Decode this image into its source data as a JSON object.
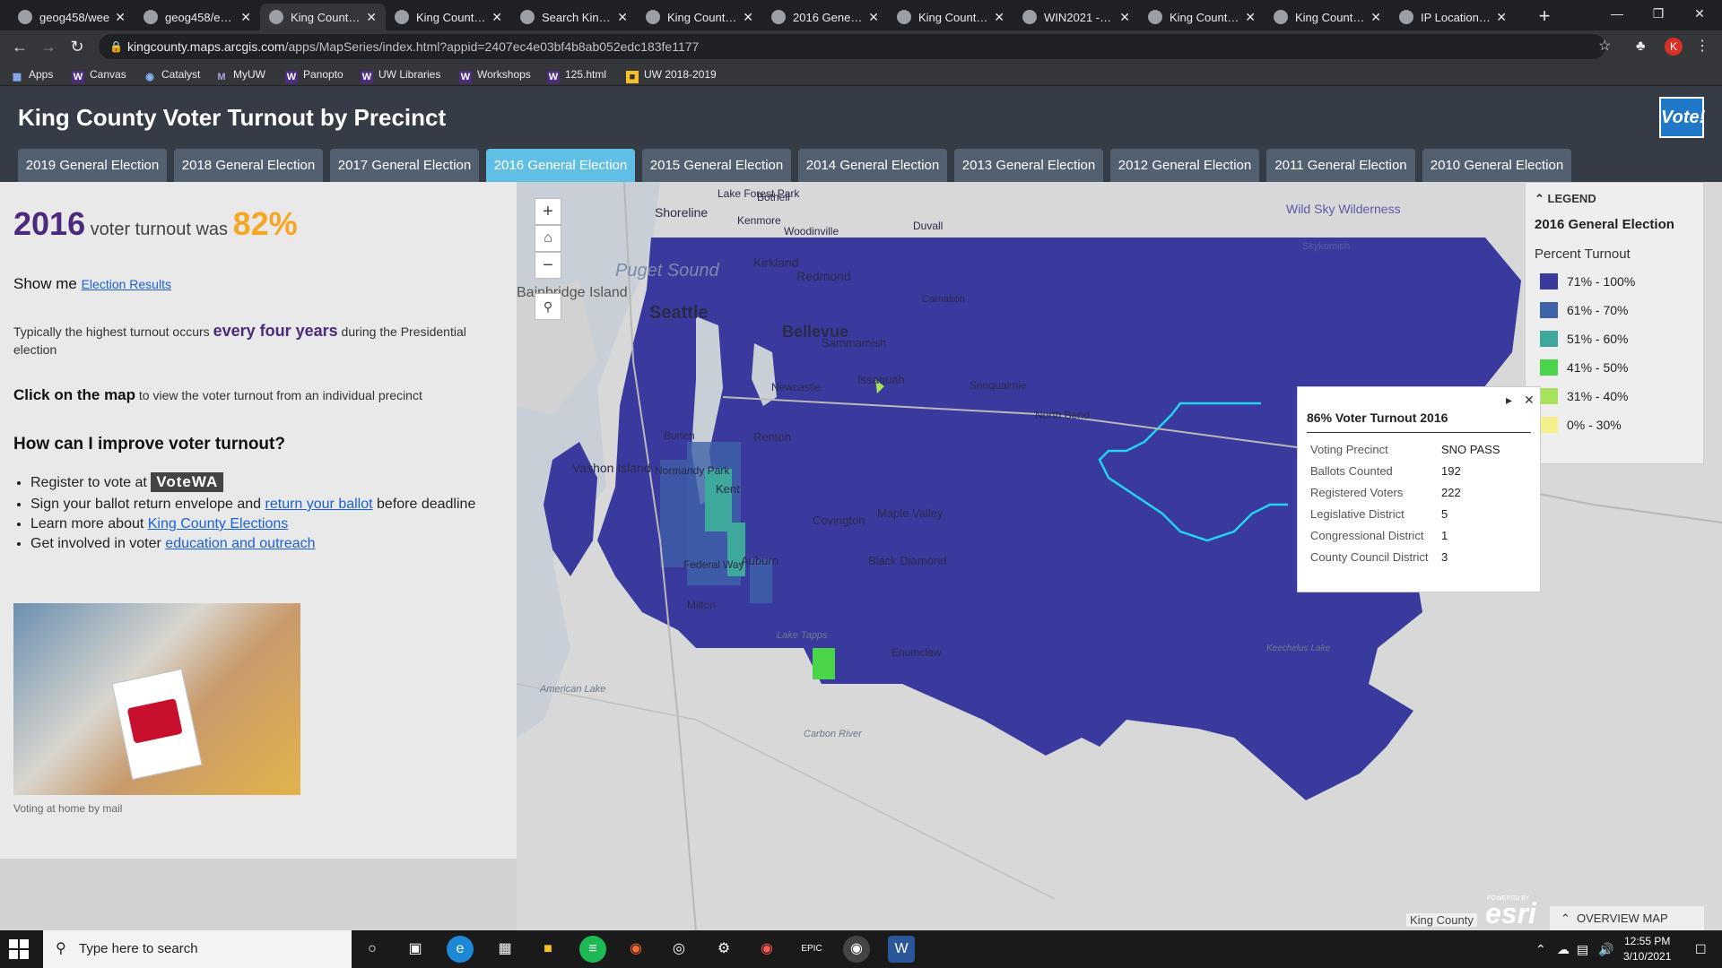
{
  "browser": {
    "tabs": [
      {
        "title": "geog458/wee",
        "icon": "github-icon"
      },
      {
        "title": "geog458/essa",
        "icon": "github-icon"
      },
      {
        "title": "King County V",
        "icon": "arcgis-icon",
        "active": true
      },
      {
        "title": "King County V",
        "icon": "arcgis-icon"
      },
      {
        "title": "Search King C",
        "icon": "search-page-icon"
      },
      {
        "title": "King County G",
        "icon": "page-icon"
      },
      {
        "title": "2016 General",
        "icon": "page-icon"
      },
      {
        "title": "King County G",
        "icon": "page-icon"
      },
      {
        "title": "WIN2021 - Go",
        "icon": "google-drive-icon"
      },
      {
        "title": "King County V",
        "icon": "arcgis-icon"
      },
      {
        "title": "King County V",
        "icon": "arcgis-icon"
      },
      {
        "title": "IP Location Fi",
        "icon": "location-icon"
      }
    ],
    "url_host": "kingcounty.maps.arcgis.com",
    "url_path": "/apps/MapSeries/index.html?appid=2407ec4e03bf4b8ab052edc183fe1177",
    "profile_initial": "K",
    "bookmarks": [
      "Apps",
      "Canvas",
      "Catalyst",
      "MyUW",
      "Panopto",
      "UW Libraries",
      "Workshops",
      "125.html",
      "UW 2018-2019"
    ]
  },
  "app": {
    "title": "King County Voter Turnout by Precinct",
    "logo_text": "Vote!",
    "tabs": [
      "2019 General Election",
      "2018 General Election",
      "2017 General Election",
      "2016 General Election",
      "2015 General Election",
      "2014 General Election",
      "2013 General Election",
      "2012 General Election",
      "2011 General Election",
      "2010 General Election"
    ],
    "active_tab_index": 3
  },
  "panel": {
    "year": "2016",
    "turnout_label": " voter turnout was ",
    "turnout_value": "82%",
    "show_me_prefix": "Show me ",
    "show_me_link": "Election Results",
    "typical_prefix": "Typically the highest turnout occurs ",
    "typical_emph": "every four years",
    "typical_suffix": " during the Presidential election",
    "click_bold": "Click on the map",
    "click_rest": " to view the voter turnout from an individual precinct",
    "improve_heading": "How can I improve voter turnout?",
    "bullet1_prefix": "Register to vote at ",
    "bullet1_badge": "VoteWA",
    "bullet2_prefix": "Sign your ballot return envelope and ",
    "bullet2_link": "return your ballot",
    "bullet2_suffix": " before deadline",
    "bullet3_prefix": "Learn more about ",
    "bullet3_link": "King County Elections",
    "bullet4_prefix": "Get involved in voter ",
    "bullet4_link": "education and outreach",
    "photo_caption": "Voting at home by mail"
  },
  "legend": {
    "header": "LEGEND",
    "title": "2016 General Election",
    "subtitle": "Percent Turnout",
    "items": [
      {
        "label": "71% - 100%",
        "color": "#3a3a9e"
      },
      {
        "label": "61% - 70%",
        "color": "#3f64a8"
      },
      {
        "label": "51% - 60%",
        "color": "#3fa89c"
      },
      {
        "label": "41% - 50%",
        "color": "#49d449"
      },
      {
        "label": "31% - 40%",
        "color": "#a6e35a"
      },
      {
        "label": "0% - 30%",
        "color": "#f4f08a"
      }
    ]
  },
  "popup": {
    "title": "86% Voter Turnout 2016",
    "rows": [
      {
        "label": "Voting Precinct",
        "value": "SNO PASS"
      },
      {
        "label": "Ballots Counted",
        "value": "192"
      },
      {
        "label": "Registered Voters",
        "value": "222"
      },
      {
        "label": "Legislative District",
        "value": "5"
      },
      {
        "label": "Congressional District",
        "value": "1"
      },
      {
        "label": "County Council District",
        "value": "3"
      }
    ]
  },
  "map": {
    "labels": [
      "Puget Sound",
      "Bainbridge Island",
      "Seattle",
      "Bellevue",
      "Kirkland",
      "Redmond",
      "Sammamish",
      "Issaquah",
      "Snoqualmie",
      "North Bend",
      "Renton",
      "Kent",
      "Auburn",
      "Covington",
      "Maple Valley",
      "Black Diamond",
      "Enumclaw",
      "Vashon Island",
      "Duvall",
      "Carnation",
      "Woodinville",
      "Bothell",
      "Lake Forest Park",
      "Shoreline",
      "Kenmore",
      "Burien",
      "Normandy Park",
      "Newcastle",
      "Federal Way",
      "Milton",
      "Lake Tapps",
      "American Lake",
      "Carbon River",
      "Keechelus Lake",
      "Wild Sky Wilderness",
      "Skykomish"
    ],
    "attribution": "King County",
    "esri_powered": "POWERED BY",
    "esri": "esri",
    "overview_label": "OVERVIEW MAP"
  },
  "taskbar": {
    "search_placeholder": "Type here to search",
    "time": "12:55 PM",
    "date": "3/10/2021"
  }
}
